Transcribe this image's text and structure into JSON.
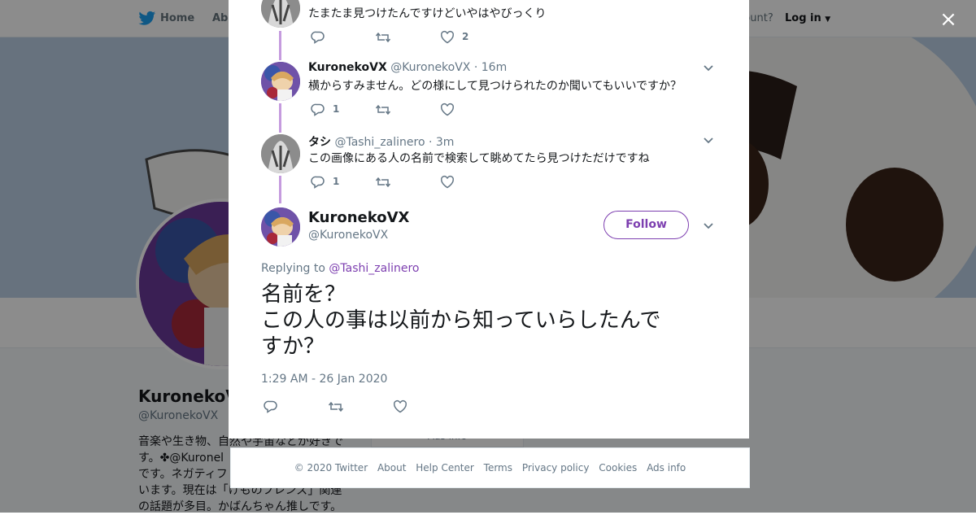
{
  "nav": {
    "home": "Home",
    "about": "Abo",
    "account": "ccount?",
    "login": "Log in"
  },
  "profile": {
    "name": "KuronekoV",
    "handle": "@KuronekoVX",
    "bio_lines": [
      "音楽や生き物、自然や宇宙などが好きで",
      "す。✤@Kuronel",
      "です。ネガティフ",
      "います。現在は「けものフレンズ」関連",
      "の話題が多目。かばんちゃん推しです。"
    ],
    "card_text": "Ads info"
  },
  "thread": [
    {
      "avatar": "tashi-avatar",
      "text": "たまたま見つけたんですけどいやはやびっくり",
      "reply_count": "",
      "like_count": "2"
    },
    {
      "avatar": "kuroneko-avatar",
      "name": "KuronekoVX",
      "handle": "@KuronekoVX",
      "sep": "·",
      "time": "16m",
      "text": "横からすみません。どの様にして見つけられたのか聞いてもいいですか？",
      "reply_count": "1",
      "like_count": ""
    },
    {
      "avatar": "tashi-avatar",
      "name": "タシ",
      "handle": "@Tashi_zalinero",
      "sep": "·",
      "time": "3m",
      "text": "この画像にある人の名前で検索して眺めてたら見つけただけですね",
      "reply_count": "1",
      "like_count": ""
    }
  ],
  "main_tweet": {
    "name": "KuronekoVX",
    "handle": "@KuronekoVX",
    "follow_label": "Follow",
    "replying_prefix": "Replying to",
    "replying_to": "@Tashi_zalinero",
    "text_line1": "名前を？",
    "text_line2": "この人の事は以前から知っていらしたんで",
    "text_line3": "すか？",
    "timestamp": "1:29 AM - 26 Jan 2020"
  },
  "footer": {
    "links": [
      "© 2020 Twitter",
      "About",
      "Help Center",
      "Terms",
      "Privacy policy",
      "Cookies",
      "Ads info"
    ]
  },
  "colors": {
    "accent": "#7d3fb0",
    "thread_line": "#c59bde",
    "muted": "#657786"
  },
  "icons": {
    "close": "×"
  }
}
